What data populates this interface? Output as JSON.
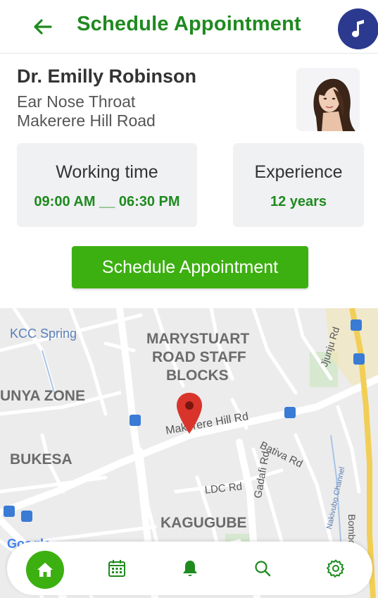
{
  "header": {
    "title": "Schedule Appointment",
    "back_icon": "arrow-left-icon",
    "music_icon": "music-note-icon"
  },
  "doctor": {
    "name": "Dr. Emilly Robinson",
    "specialty": "Ear Nose Throat",
    "address": "Makerere Hill Road"
  },
  "working_time": {
    "title": "Working time",
    "value": "09:00 AM __ 06:30 PM"
  },
  "experience": {
    "title": "Experience",
    "value": "12 years"
  },
  "cta_label": "Schedule Appointment",
  "map": {
    "labels": {
      "kcc_spring": "KCC Spring",
      "marystuart_1": "MARYSTUART",
      "marystuart_2": "ROAD STAFF",
      "marystuart_3": "BLOCKS",
      "unya_zone": "UNYA ZONE",
      "makerere_hill_rd": "Makerere Hill Rd",
      "bukesa": "BUKESA",
      "bativa_rd": "Bativa Rd",
      "gadafi_rd": "Gadafi Rd",
      "ldc_rd": "LDC Rd",
      "kagugube": "KAGUGUBE",
      "jjunju_rd": "Jjunju Rd",
      "bombo_rd": "Bombo Rd",
      "nakivubo_channel": "Nakivubo Channel",
      "google": "Google"
    }
  },
  "nav": {
    "items": [
      "home-icon",
      "calendar-icon",
      "bell-icon",
      "search-icon",
      "settings-icon"
    ],
    "active": "home"
  },
  "colors": {
    "brand_green": "#1f8a1f",
    "button_green": "#3cb011",
    "music_blue": "#2b3a8f",
    "pin_red": "#d9342b"
  }
}
